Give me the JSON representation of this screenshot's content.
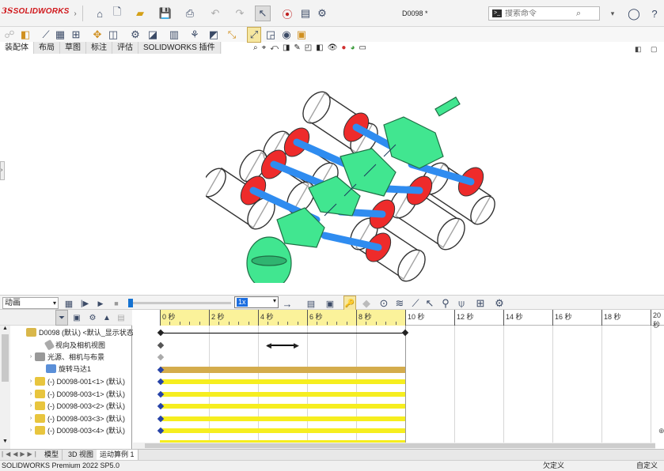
{
  "app": {
    "brand_ds": "3S",
    "brand_name": "SOLIDWORKS",
    "doc_title": "D0098 *"
  },
  "search": {
    "placeholder": "搜索命令"
  },
  "ribbon_tabs": [
    "装配体",
    "布局",
    "草图",
    "标注",
    "评估",
    "SOLIDWORKS 插件"
  ],
  "motion": {
    "study_type": "动画",
    "speed": "1x",
    "tree_items": [
      {
        "label": "D0098 (默认) <默认_显示状态",
        "icon": "assembly-icon",
        "expand": false
      },
      {
        "label": "视向及相机视图",
        "icon": "camera-view-icon",
        "expand": false
      },
      {
        "label": "光源、相机与布景",
        "icon": "light-icon",
        "expand": true
      },
      {
        "label": "旋转马达1",
        "icon": "motor-icon",
        "expand": false
      },
      {
        "label": "(-) D0098-001<1> (默认)",
        "icon": "part-icon",
        "expand": true
      },
      {
        "label": "(-) D0098-003<1> (默认)",
        "icon": "part-icon",
        "expand": true
      },
      {
        "label": "(-) D0098-003<2> (默认)",
        "icon": "part-icon",
        "expand": true
      },
      {
        "label": "(-) D0098-003<3> (默认)",
        "icon": "part-icon",
        "expand": true
      },
      {
        "label": "(-) D0098-003<4> (默认)",
        "icon": "part-icon",
        "expand": true
      }
    ],
    "ruler_labels": [
      "0 秒",
      "2 秒",
      "4 秒",
      "6 秒",
      "8 秒",
      "10 秒",
      "12 秒",
      "14 秒",
      "16 秒",
      "18 秒",
      "20 秒"
    ]
  },
  "bottom_tabs": [
    "模型",
    "3D 视图",
    "运动算例 1"
  ],
  "status": {
    "product": "SOLIDWORKS Premium 2022 SP5.0",
    "state": "欠定义",
    "custom": "自定义"
  },
  "colors": {
    "accent": "#d0171b",
    "timeline_yellow": "#fbf29a",
    "bar_yellow": "#f6ee1f",
    "motor_bar": "#d4ac4c",
    "part_green": "#41e690",
    "rod_blue": "#2f8cf0",
    "piston_red": "#ee2b2b"
  }
}
